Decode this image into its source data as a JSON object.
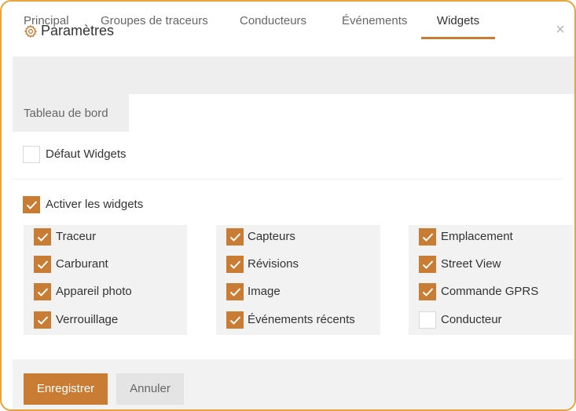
{
  "dialog": {
    "title": "Paramètres",
    "close_symbol": "×",
    "title_icon": "gear-icon",
    "accent_color": "#c97d34",
    "border_color": "#e8a33d"
  },
  "tabs": [
    {
      "label": "Principal",
      "active": false
    },
    {
      "label": "Groupes de traceurs",
      "active": false
    },
    {
      "label": "Conducteurs",
      "active": false
    },
    {
      "label": "Événements",
      "active": false
    },
    {
      "label": "Widgets",
      "active": true
    },
    {
      "label": "Tableau de bord",
      "active": false
    }
  ],
  "content": {
    "default_widgets": {
      "label": "Défaut Widgets",
      "checked": false
    },
    "enable_widgets": {
      "label": "Activer les widgets",
      "checked": true
    },
    "columns": [
      [
        {
          "label": "Traceur",
          "checked": true
        },
        {
          "label": "Carburant",
          "checked": true
        },
        {
          "label": "Appareil photo",
          "checked": true
        },
        {
          "label": "Verrouillage",
          "checked": true
        }
      ],
      [
        {
          "label": "Capteurs",
          "checked": true
        },
        {
          "label": "Révisions",
          "checked": true
        },
        {
          "label": "Image",
          "checked": true
        },
        {
          "label": "Événements récents",
          "checked": true
        }
      ],
      [
        {
          "label": "Emplacement",
          "checked": true
        },
        {
          "label": "Street View",
          "checked": true
        },
        {
          "label": "Commande GPRS",
          "checked": true
        },
        {
          "label": "Conducteur",
          "checked": false
        }
      ]
    ]
  },
  "footer": {
    "save_label": "Enregistrer",
    "cancel_label": "Annuler"
  }
}
